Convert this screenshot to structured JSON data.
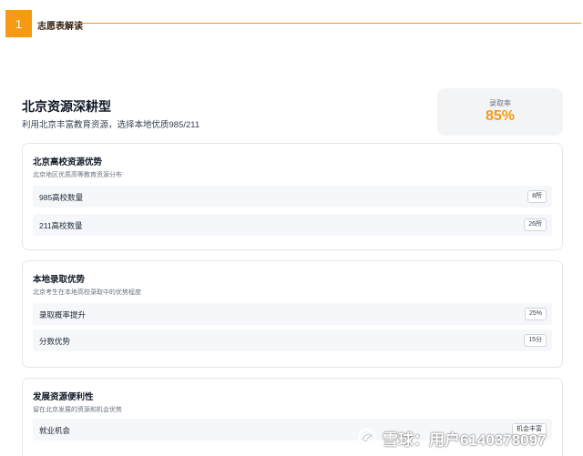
{
  "section": {
    "number": "1",
    "title": "志愿表解读"
  },
  "hero": {
    "title": "北京资源深耕型",
    "subtitle": "利用北京丰富教育资源，选择本地优质985/211"
  },
  "rate": {
    "label": "录取率",
    "value": "85%"
  },
  "cards": [
    {
      "title": "北京高校资源优势",
      "desc": "北京地区优质高等教育资源分布",
      "rows": [
        {
          "label": "985高校数量",
          "badge": "8所"
        },
        {
          "label": "211高校数量",
          "badge": "26所"
        }
      ]
    },
    {
      "title": "本地录取优势",
      "desc": "北京考生在本地高校录取中的优势程度",
      "rows": [
        {
          "label": "录取概率提升",
          "badge": "25%"
        },
        {
          "label": "分数优势",
          "badge": "15分"
        }
      ]
    },
    {
      "title": "发展资源便利性",
      "desc": "留在北京发展的资源和机会优势",
      "rows": [
        {
          "label": "就业机会",
          "badge": "机会丰富"
        }
      ]
    }
  ],
  "watermark": {
    "text": "雪球：用户6140378097"
  },
  "colors": {
    "accent": "#f59a12",
    "card_border": "#e5e7eb",
    "row_bg": "#f5f7fa"
  }
}
